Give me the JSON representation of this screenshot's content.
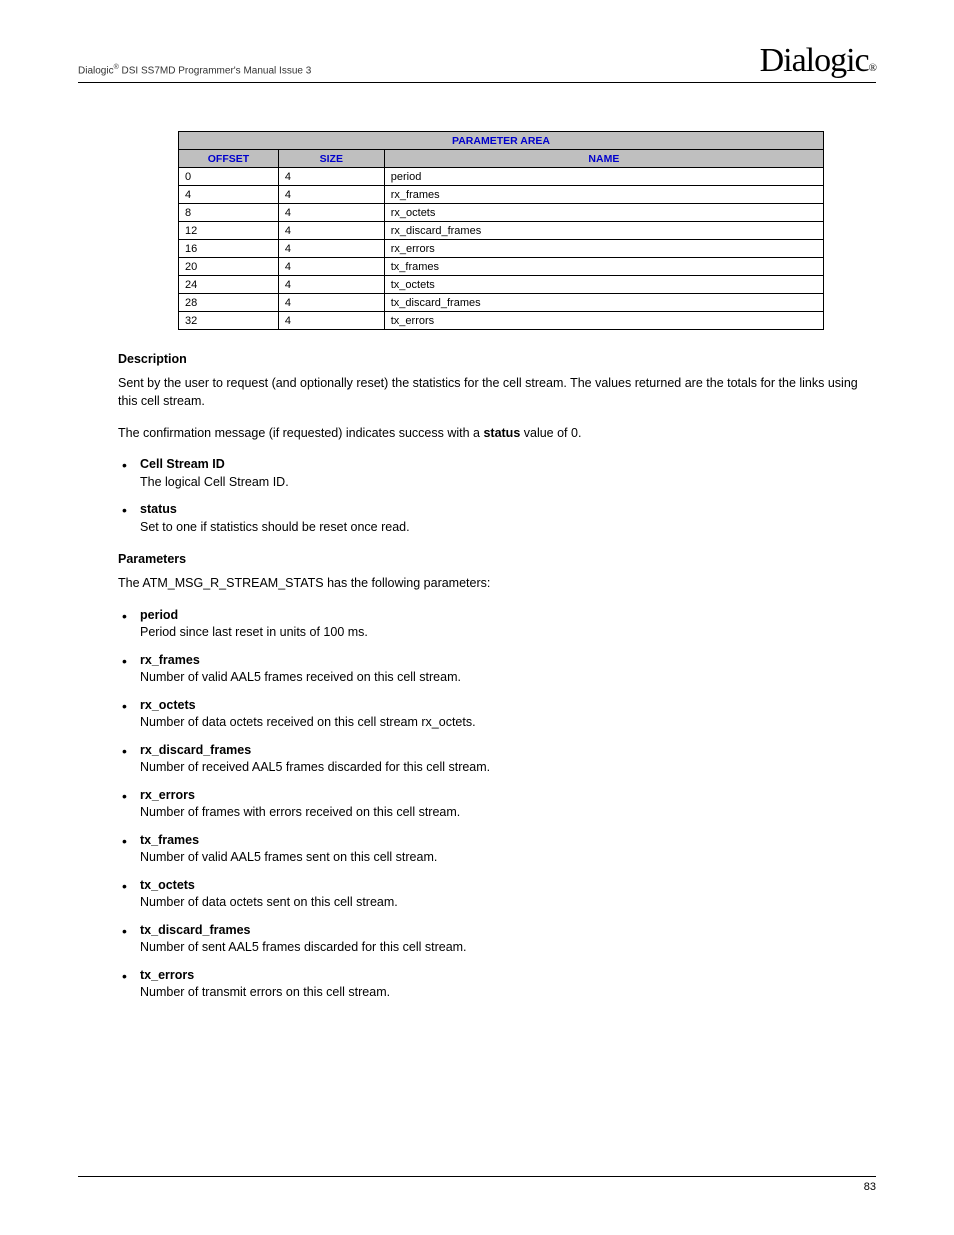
{
  "header": {
    "doc_title_prefix": "Dialogic",
    "doc_title_suffix": " DSI SS7MD Programmer's Manual  Issue 3",
    "logo_text": "Dialogic",
    "logo_reg": "®"
  },
  "table": {
    "title": "PARAMETER AREA",
    "cols": {
      "offset": "OFFSET",
      "size": "SIZE",
      "name": "NAME"
    },
    "rows": [
      {
        "offset": "0",
        "size": "4",
        "name": "period"
      },
      {
        "offset": "4",
        "size": "4",
        "name": "rx_frames"
      },
      {
        "offset": "8",
        "size": "4",
        "name": "rx_octets"
      },
      {
        "offset": "12",
        "size": "4",
        "name": "rx_discard_frames"
      },
      {
        "offset": "16",
        "size": "4",
        "name": "rx_errors"
      },
      {
        "offset": "20",
        "size": "4",
        "name": "tx_frames"
      },
      {
        "offset": "24",
        "size": "4",
        "name": "tx_octets"
      },
      {
        "offset": "28",
        "size": "4",
        "name": "tx_discard_frames"
      },
      {
        "offset": "32",
        "size": "4",
        "name": "tx_errors"
      }
    ]
  },
  "description": {
    "heading": "Description",
    "p1": "Sent by the user to request (and optionally reset) the statistics for the cell stream. The values returned are the totals for the links using this cell stream.",
    "p2_a": "The confirmation message (if requested) indicates success with a ",
    "p2_b": "status",
    "p2_c": " value of 0.",
    "items": [
      {
        "term": "Cell Stream ID",
        "def": "The logical Cell Stream ID."
      },
      {
        "term": "status",
        "def": "Set to one if statistics should be reset once read."
      }
    ]
  },
  "parameters": {
    "heading": "Parameters",
    "intro": "The ATM_MSG_R_STREAM_STATS has the following parameters:",
    "items": [
      {
        "term": "period",
        "def": "Period since last reset in units of 100 ms."
      },
      {
        "term": "rx_frames",
        "def": "Number of valid AAL5 frames received on this cell stream."
      },
      {
        "term": "rx_octets",
        "def": "Number of data octets received on this cell stream rx_octets."
      },
      {
        "term": "rx_discard_frames",
        "def": "Number of received AAL5 frames discarded for this cell stream."
      },
      {
        "term": "rx_errors",
        "def": "Number of frames with errors received on this cell stream."
      },
      {
        "term": "tx_frames",
        "def": "Number of valid AAL5 frames sent on this cell stream."
      },
      {
        "term": "tx_octets",
        "def": "Number of data octets sent on this cell stream."
      },
      {
        "term": "tx_discard_frames",
        "def": "Number of sent AAL5 frames discarded for this cell stream."
      },
      {
        "term": "tx_errors",
        "def": "Number of transmit errors on this cell stream."
      }
    ]
  },
  "footer": {
    "page": "83"
  }
}
